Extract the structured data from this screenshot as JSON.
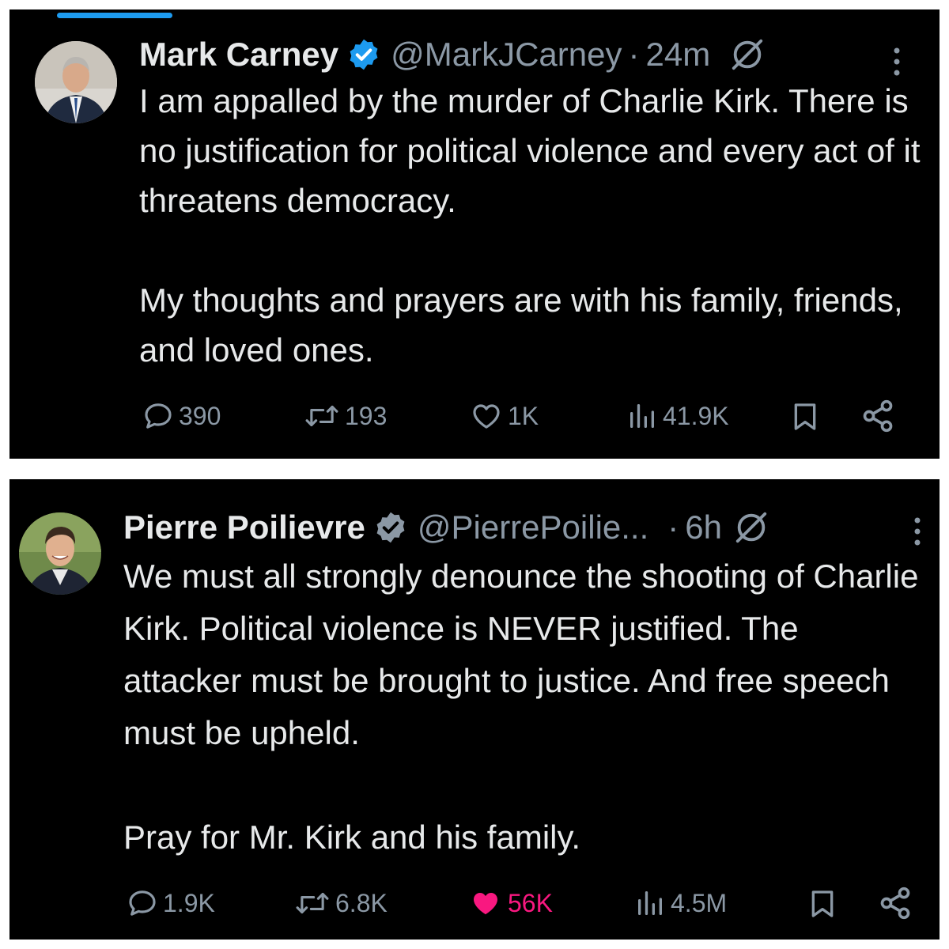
{
  "colors": {
    "background": "#000000",
    "text": "#e7e9ea",
    "muted": "#8b98a5",
    "verified": "#1d9bf0",
    "like_active": "#f91880"
  },
  "tweets": [
    {
      "author": {
        "name": "Mark Carney",
        "handle": "@MarkJCarney",
        "separator": "·",
        "time": "24m",
        "verified": true,
        "avatar_icon": "avatar-mark-carney"
      },
      "body": [
        "I am appalled by the murder of Charlie Kirk. There is no justification for political violence and every act of it threatens democracy.",
        "My thoughts and prayers are with his family, friends, and loved ones."
      ],
      "actions": {
        "replies": "390",
        "reposts": "193",
        "likes": "1K",
        "views": "41.9K",
        "liked": false
      }
    },
    {
      "author": {
        "name": "Pierre Poilievre",
        "handle": "@PierrePoilie...",
        "separator": "·",
        "time": "6h",
        "verified": true,
        "avatar_icon": "avatar-pierre-poilievre"
      },
      "body": [
        "We must all strongly denounce the shooting of Charlie Kirk. Political violence is NEVER justified. The attacker must be brought to justice. And free speech must be upheld.",
        "Pray for Mr. Kirk and his family."
      ],
      "actions": {
        "replies": "1.9K",
        "reposts": "6.8K",
        "likes": "56K",
        "views": "4.5M",
        "liked": true
      }
    }
  ],
  "icons": [
    "reply-icon",
    "repost-icon",
    "like-icon",
    "views-icon",
    "bookmark-icon",
    "share-icon",
    "verified-badge-icon",
    "grok-icon",
    "more-icon"
  ]
}
